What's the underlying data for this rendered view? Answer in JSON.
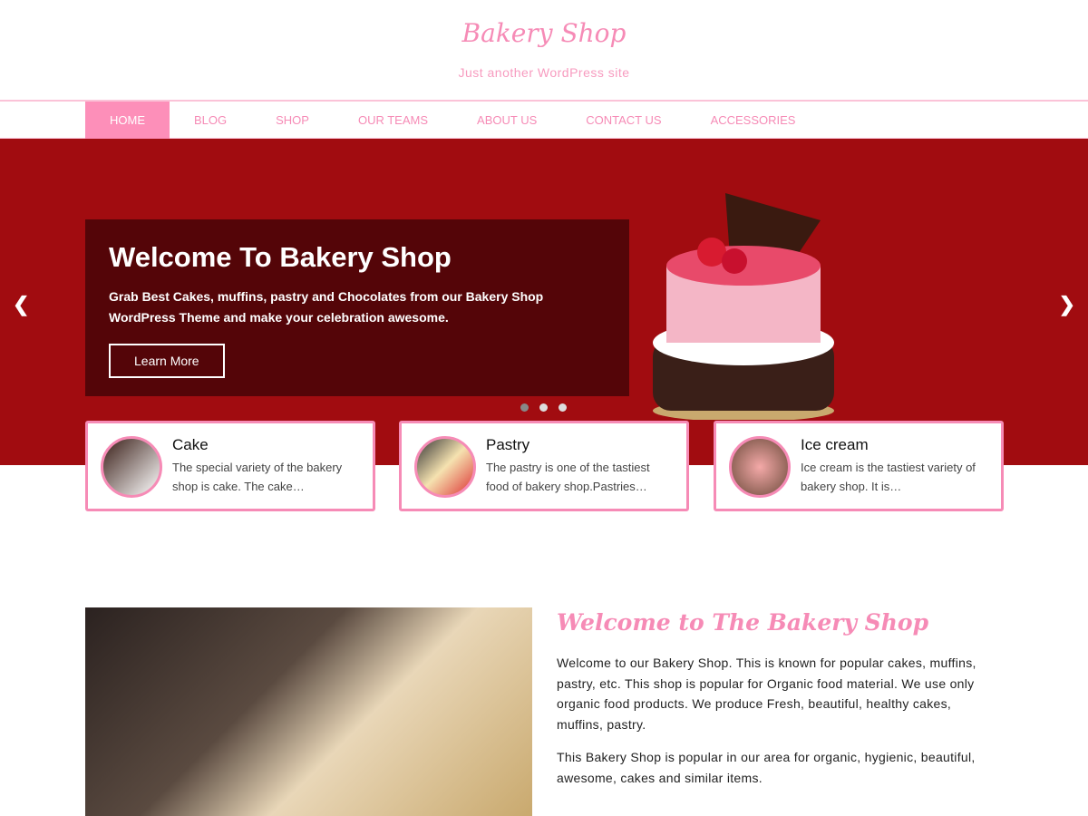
{
  "header": {
    "title": "Bakery Shop",
    "tagline": "Just another WordPress site"
  },
  "nav": [
    "HOME",
    "BLOG",
    "SHOP",
    "OUR TEAMS",
    "ABOUT US",
    "CONTACT US",
    "ACCESSORIES"
  ],
  "slider": {
    "title": "Welcome To Bakery Shop",
    "text": "Grab Best Cakes, muffins, pastry and Chocolates from our Bakery Shop WordPress Theme and make your celebration awesome.",
    "button": "Learn More",
    "active_dot": 1,
    "dot_count": 3
  },
  "cards": [
    {
      "title": "Cake",
      "text": "The special variety of the bakery shop is cake. The cake…"
    },
    {
      "title": "Pastry",
      "text": "The pastry is one of the tastiest food of bakery shop.Pastries…"
    },
    {
      "title": "Ice cream",
      "text": "Ice cream is the tastiest variety of bakery shop. It is…"
    }
  ],
  "about": {
    "title": "Welcome to The Bakery Shop",
    "p1": "Welcome to our Bakery Shop. This is known for popular cakes, muffins, pastry, etc. This shop is popular for Organic food material. We use only organic food products. We produce Fresh, beautiful, healthy cakes, muffins, pastry.",
    "p2": "This Bakery Shop is popular in our area for organic, hygienic, beautiful, awesome, cakes and similar items."
  },
  "colors": {
    "accent": "#f68bb6",
    "hero": "#a10c10",
    "caption": "#540508"
  }
}
